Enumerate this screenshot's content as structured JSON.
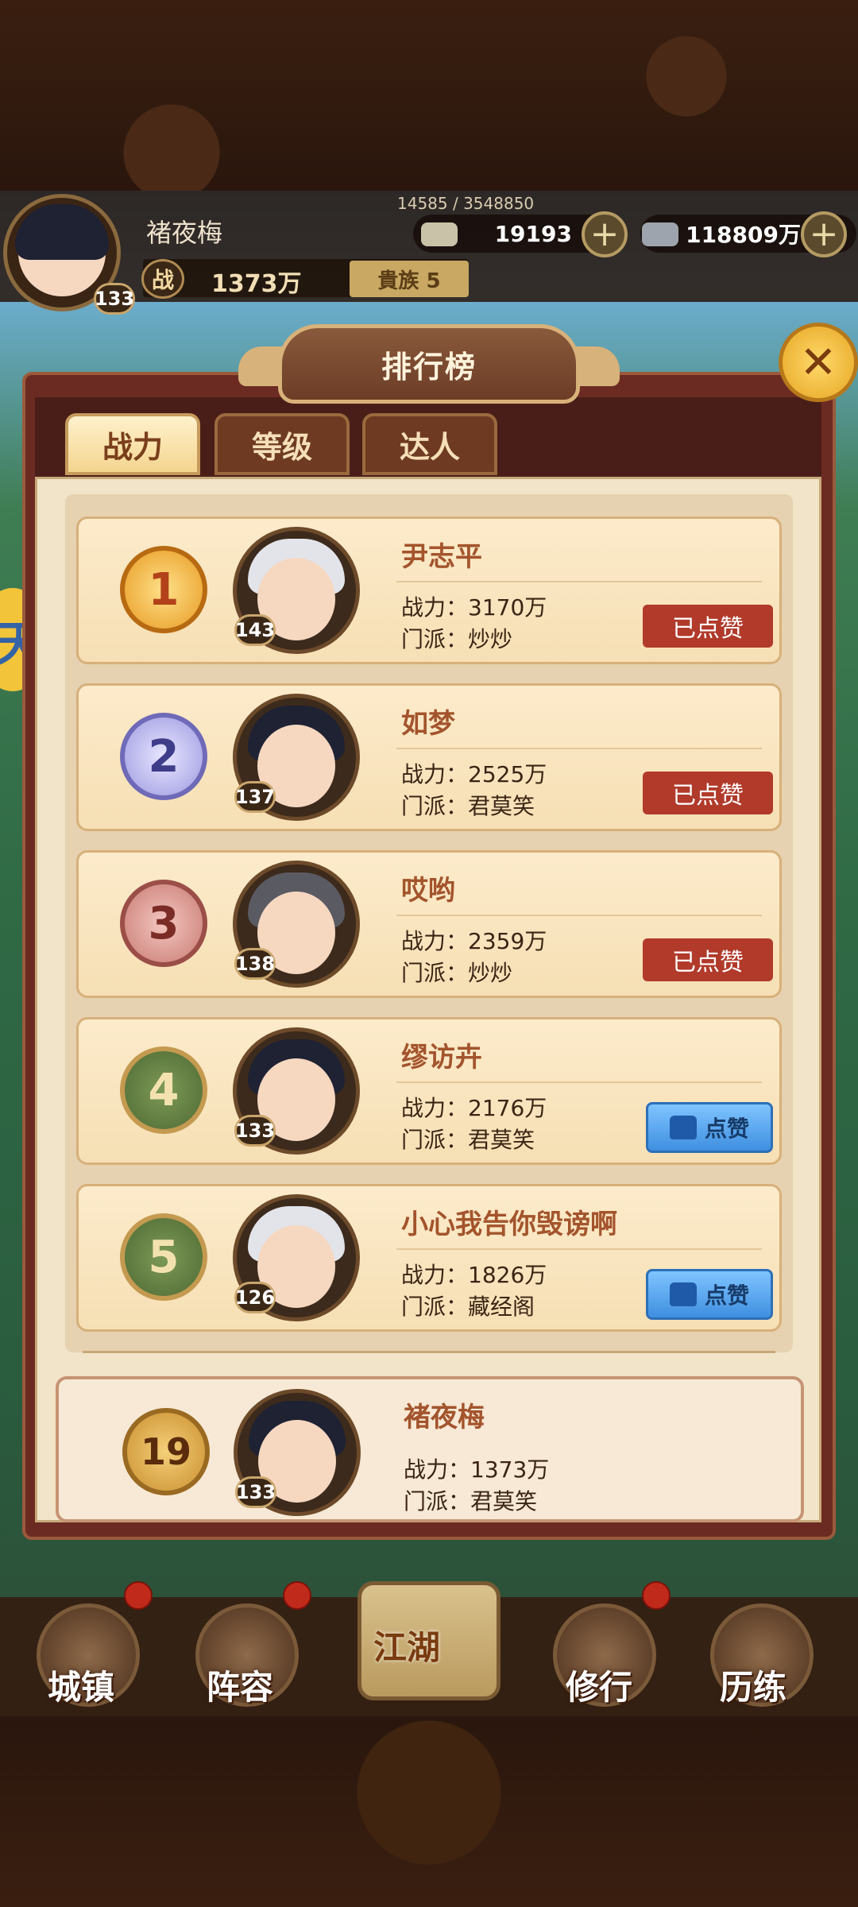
{
  "header": {
    "player_name": "褚夜梅",
    "player_level": "133",
    "exp_text": "14585 / 3548850",
    "gold": "19193",
    "silver": "118809万",
    "power_icon": "战",
    "power": "1373万",
    "noble": "貴族 5"
  },
  "side": {
    "yellow_item": "天"
  },
  "panel": {
    "title": "排行榜",
    "close_icon": "close-icon",
    "tabs": [
      {
        "label": "战力",
        "active": true
      },
      {
        "label": "等级",
        "active": false
      },
      {
        "label": "达人",
        "active": false
      }
    ]
  },
  "rankings": [
    {
      "rank": "1",
      "level": "143",
      "name": "尹志平",
      "power": "战力：3170万",
      "sect": "门派：炒炒",
      "button": "已点赞"
    },
    {
      "rank": "2",
      "level": "137",
      "name": "如梦",
      "power": "战力：2525万",
      "sect": "门派：君莫笑",
      "button": "已点赞"
    },
    {
      "rank": "3",
      "level": "138",
      "name": "哎哟",
      "power": "战力：2359万",
      "sect": "门派：炒炒",
      "button": "已点赞"
    },
    {
      "rank": "4",
      "level": "133",
      "name": "缪访卉",
      "power": "战力：2176万",
      "sect": "门派：君莫笑",
      "button": "点赞"
    },
    {
      "rank": "5",
      "level": "126",
      "name": "小心我告你毁谤啊",
      "power": "战力：1826万",
      "sect": "门派：藏经阁",
      "button": "点赞"
    }
  ],
  "self_rank": {
    "rank": "19",
    "level": "133",
    "name": "褚夜梅",
    "power": "战力：1373万",
    "sect": "门派：君莫笑"
  },
  "nav": [
    {
      "label": "城镇"
    },
    {
      "label": "阵容"
    },
    {
      "label": "江湖"
    },
    {
      "label": "修行"
    },
    {
      "label": "历练"
    }
  ],
  "colors": {
    "gold_badge": "#f2b33a",
    "silver_badge": "#a9a6e6",
    "bronze_badge": "#c77a72",
    "green_badge": "#5d7a3c",
    "liked_button": "#b13a2a",
    "like_button": "#3f8fe0"
  }
}
